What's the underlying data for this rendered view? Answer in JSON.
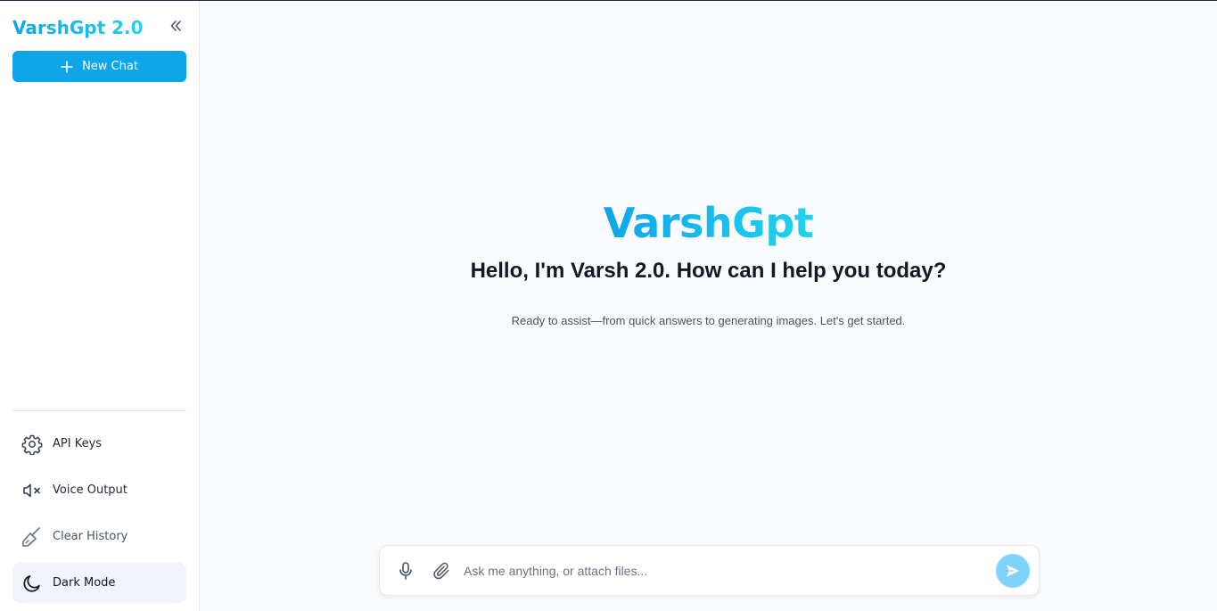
{
  "sidebar": {
    "brand": "VarshGpt 2.0",
    "new_chat_label": "New Chat",
    "menu": [
      {
        "label": "API Keys",
        "icon": "gear-icon"
      },
      {
        "label": "Voice Output",
        "icon": "speaker-muted-icon"
      },
      {
        "label": "Clear History",
        "icon": "broom-icon"
      },
      {
        "label": "Dark Mode",
        "icon": "moon-icon"
      }
    ]
  },
  "main": {
    "logo": "VarshGpt",
    "greeting": "Hello, I'm Varsh 2.0. How can I help you today?",
    "subtext": "Ready to assist—from quick answers to generating images. Let's get started."
  },
  "composer": {
    "placeholder": "Ask me anything, or attach files...",
    "value": ""
  },
  "colors": {
    "accent": "#0ea5e9",
    "accent_light": "#22d3ee",
    "send_button": "#7dd3fc",
    "background": "#f8fafc"
  }
}
